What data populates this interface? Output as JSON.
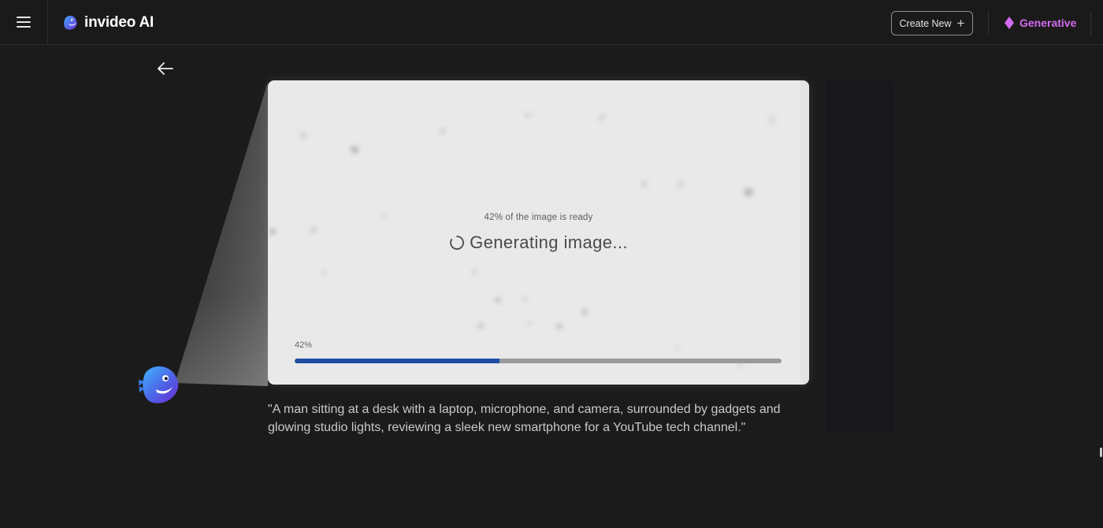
{
  "header": {
    "app_name": "invideo AI",
    "create_button_label": "Create New",
    "create_button_icon": "plus-icon",
    "plan_badge_label": "Generative",
    "plan_badge_color": "#d06bef",
    "menu_icon": "hamburger-icon"
  },
  "main": {
    "back_icon": "arrow-left-icon",
    "preview": {
      "status_text": "42% of the image is ready",
      "generating_label": "Generating image...",
      "progress_label": "42%",
      "progress_value": 0.42,
      "progress_color": "#1d4ea3"
    },
    "prompt_text": "\"A man sitting at a desk with a laptop, microphone, and camera, surrounded by gadgets and glowing studio lights, reviewing a sleek new smartphone for a YouTube tech channel.\""
  },
  "colors": {
    "background": "#1b1b1b",
    "accent": "#d06bef",
    "progress": "#1d4ea3"
  }
}
